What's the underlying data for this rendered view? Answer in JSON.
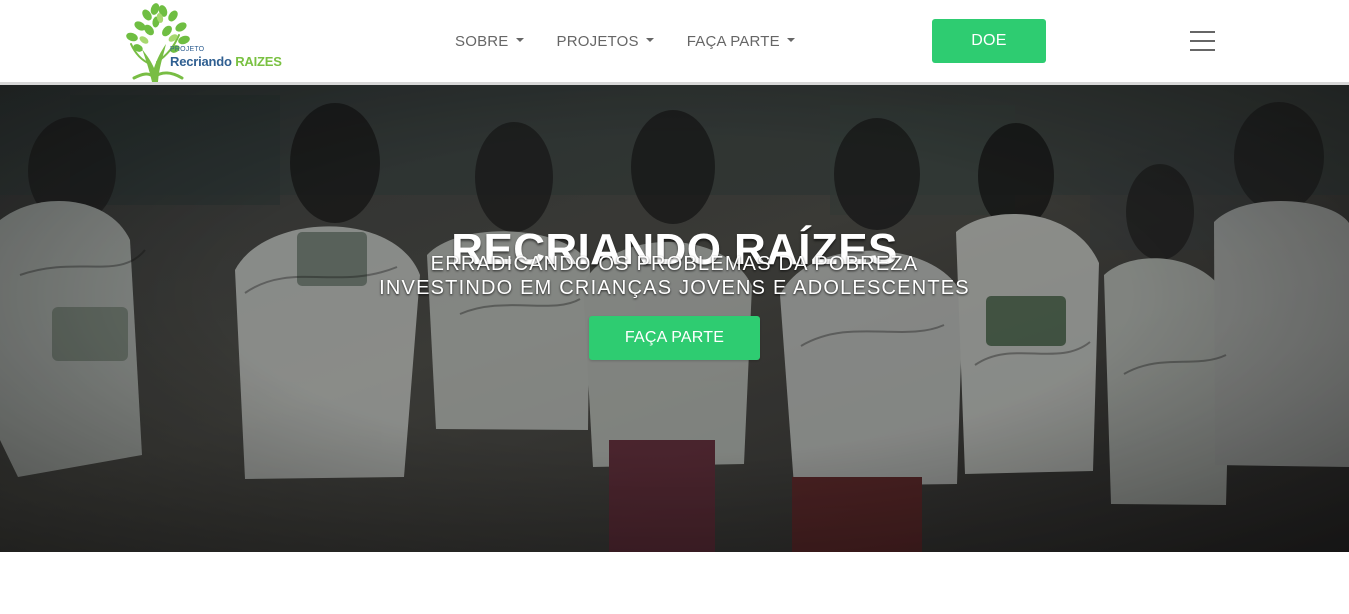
{
  "header": {
    "logo": {
      "small_text": "PROJETO",
      "main_text_1": "Recriando",
      "main_text_2": "RAIZES"
    },
    "nav_items": [
      {
        "label": "SOBRE",
        "dropdown": true
      },
      {
        "label": "PROJETOS",
        "dropdown": true
      },
      {
        "label": "FAÇA PARTE",
        "dropdown": true
      }
    ],
    "donate_label": "DOE",
    "menu_icon": "hamburger-menu-icon"
  },
  "hero": {
    "title": "RECRIANDO RAÍZES",
    "subtitle_line_1": "ERRADICANDO OS PROBLEMAS DA POBREZA",
    "subtitle_line_2": "INVESTINDO EM CRIANÇAS JOVENS E ADOLESCENTES",
    "cta_label": "FAÇA PARTE"
  },
  "colors": {
    "accent_green": "#2ecc71",
    "logo_blue": "#2f5f91",
    "logo_green": "#7ac142",
    "nav_text": "#666666"
  }
}
